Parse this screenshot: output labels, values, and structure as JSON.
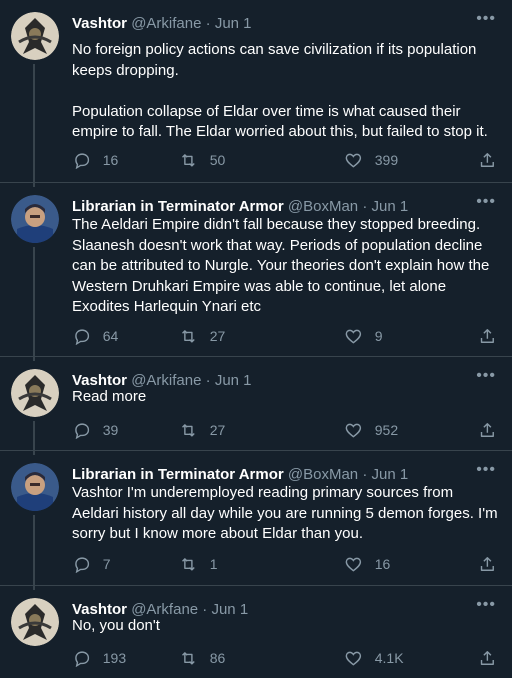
{
  "tweets": [
    {
      "name": "Vashtor",
      "handle": "@Arkifane",
      "date": "Jun 1",
      "body": "No foreign policy actions can save civilization if its population keeps dropping.\n\nPopulation collapse of Eldar over time is what caused their empire to fall. The Eldar worried about this, but failed to stop it.",
      "replies": "16",
      "retweets": "50",
      "likes": "399"
    },
    {
      "name": "Librarian in Terminator Armor",
      "handle": "@BoxMan",
      "date": "Jun 1",
      "body": "The Aeldari Empire didn't fall because they stopped breeding. Slaanesh doesn't work that way. Periods of population decline can be attributed to Nurgle. Your theories don't explain how the Western Druhkari Empire was able to continue, let alone Exodites Harlequin Ynari etc",
      "replies": "64",
      "retweets": "27",
      "likes": "9"
    },
    {
      "name": "Vashtor",
      "handle": "@Arkifane",
      "date": "Jun 1",
      "body": "Read more",
      "replies": "39",
      "retweets": "27",
      "likes": "952"
    },
    {
      "name": "Librarian in Terminator Armor",
      "handle": "@BoxMan",
      "date": "Jun 1",
      "body": "Vashtor I'm underemployed reading primary sources from Aeldari history all day while you are running 5 demon forges. I'm sorry but I know more about Eldar than you.",
      "replies": "7",
      "retweets": "1",
      "likes": "16"
    },
    {
      "name": "Vashtor",
      "handle": "@Arkfane",
      "date": "Jun 1",
      "body": "No, you don't",
      "replies": "193",
      "retweets": "86",
      "likes": "4.1K"
    }
  ],
  "separator": "·",
  "icons": {
    "reply": "reply-icon",
    "retweet": "retweet-icon",
    "like": "heart-icon",
    "share": "share-icon",
    "more": "more-icon"
  },
  "colors": {
    "background": "#15202b",
    "text": "#ffffff",
    "muted": "#8899a6",
    "border": "#38444d"
  }
}
